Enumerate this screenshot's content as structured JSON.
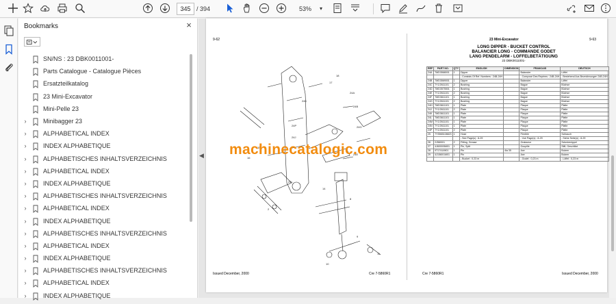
{
  "toolbar": {
    "page_current": "345",
    "page_total": "/  394",
    "zoom": "53%"
  },
  "bookmarks_panel": {
    "title": "Bookmarks",
    "close": "×",
    "items": [
      {
        "label": "SN/NS : 23 DBK0011001-",
        "expandable": false
      },
      {
        "label": "Parts Catalogue - Catalogue Pièces",
        "expandable": false
      },
      {
        "label": "Ersatzteilkatalog",
        "expandable": false
      },
      {
        "label": "23 Mini-Excavator",
        "expandable": false
      },
      {
        "label": "Mini-Pelle 23",
        "expandable": false
      },
      {
        "label": "Minibagger 23",
        "expandable": true
      },
      {
        "label": "ALPHABETICAL INDEX",
        "expandable": true
      },
      {
        "label": "INDEX ALPHABETIQUE",
        "expandable": true
      },
      {
        "label": "ALPHABETISCHES INHALTSVERZEICHNIS",
        "expandable": true
      },
      {
        "label": "ALPHABETICAL INDEX",
        "expandable": true
      },
      {
        "label": "INDEX ALPHABETIQUE",
        "expandable": true
      },
      {
        "label": "ALPHABETISCHES INHALTSVERZEICHNIS",
        "expandable": true
      },
      {
        "label": "ALPHABETICAL INDEX",
        "expandable": true
      },
      {
        "label": "INDEX ALPHABETIQUE",
        "expandable": true
      },
      {
        "label": "ALPHABETISCHES INHALTSVERZEICHNIS",
        "expandable": true
      },
      {
        "label": "ALPHABETICAL INDEX",
        "expandable": true
      },
      {
        "label": "INDEX ALPHABETIQUE",
        "expandable": true
      },
      {
        "label": "ALPHABETISCHES INHALTSVERZEICHNIS",
        "expandable": true
      },
      {
        "label": "ALPHABETICAL INDEX",
        "expandable": true
      },
      {
        "label": "INDEX ALPHABETIQUE",
        "expandable": true
      }
    ]
  },
  "document": {
    "left_page_number": "9-62",
    "right_header": "23 Mini-Excavator",
    "right_page_number": "9-63",
    "title_lines": [
      "LONG DIPPER - BUCKET CONTROL",
      "BALANCIER LONG - COMMANDE GODET",
      "LANG PENDELARM - LOFFELBETÄTIGUNG"
    ],
    "serial": "23 DBK0011001-",
    "watermark": "machinecatalogic.com",
    "footer_left": "Issued December, 2000",
    "footer_left_code": "Cre 7-5860R1",
    "footer_right_code": "Cre 7-5860R1",
    "footer_right": "Issued December, 2000",
    "table_headers": [
      "REF",
      "PART NO.",
      "QTY",
      "ENGLISH",
      "DIMENSION",
      "FRANCAIS",
      "DEUTSCH",
      "CAMES"
    ],
    "table_rows": [
      [
        "24A",
        "7MD3568001",
        "1",
        "Dipper",
        "",
        "Balancier",
        "Löffel",
        "92923"
      ],
      [
        "",
        "",
        "",
        "- Consists Of Ref. Numbers : 24B-24H",
        "",
        "- Composé Des Repères : 24B-24H",
        "- Bestehend Aus Bezeichnungen 24B-24H",
        ""
      ],
      [
        "24B",
        "7MD3569001",
        "1",
        "Dipper",
        "",
        "Balancier",
        "Löffel",
        "92923"
      ],
      [
        "24C",
        "7Y1/2611101",
        "2",
        "Bushing",
        "",
        "Bague",
        "Büchse",
        "92923"
      ],
      [
        "24D",
        "7MD3575501",
        "1",
        "Bushing",
        "",
        "Bague",
        "Büchse",
        "92923"
      ],
      [
        "24E",
        "7Y1/2611101",
        "2",
        "Bushing",
        "",
        "Bague",
        "Büchse",
        "92923"
      ],
      [
        "24F",
        "7MD3611101",
        "1",
        "Bushing",
        "",
        "Bague",
        "Büchse",
        "92923"
      ],
      [
        "24G",
        "7Y1/2611101",
        "2",
        "Bushing",
        "",
        "Bague",
        "Büchse",
        "92923"
      ],
      [
        "24H",
        "7MD3611101",
        "1",
        "Plate",
        "",
        "Plaque",
        "Platte",
        "92923"
      ],
      [
        "24J",
        "7Y1/2611101",
        "2",
        "Plate",
        "",
        "Plaque",
        "Platte",
        "92923"
      ],
      [
        "24K",
        "7MD3611101",
        "1",
        "Plate",
        "",
        "Plaque",
        "Platte",
        "92923"
      ],
      [
        "24L",
        "7MD3611101",
        "1",
        "Plate",
        "",
        "Plaque",
        "Platte",
        "92923"
      ],
      [
        "24M",
        "7Y1/2611101",
        "1",
        "Plate",
        "",
        "Plaque",
        "Platte",
        "92923"
      ],
      [
        "24N",
        "7Y1/2611101",
        "1",
        "Plate",
        "",
        "Plaque",
        "Platte",
        "92923"
      ],
      [
        "24P",
        "7Y1/2611101",
        "2",
        "Plate",
        "",
        "Plaque",
        "Platte",
        "92923"
      ],
      [
        "25",
        "7Y5565108823",
        "1",
        "Hose",
        "",
        "Flexible",
        "Schlauch",
        "92923"
      ],
      [
        "",
        "",
        "",
        "- See Page(s) : 8-29",
        "",
        "- Voir Page(s) : 8-29",
        "- Siehe Seite(n) : 8-29",
        ""
      ],
      [
        "26",
        "2J5600/1",
        "2",
        "Fitting, Grease",
        "",
        "Graisseur",
        "Schmiernippel",
        "90151"
      ],
      [
        "27",
        "4J6000/5M01",
        "1",
        "Pin, Split",
        "",
        "Goupille",
        "Stift, Geschlitzt",
        "92923"
      ],
      [
        "28",
        "9T1741/M01",
        "1",
        "Pin",
        "4ia 35",
        "Axe",
        "Bolzen",
        "92923"
      ],
      [
        "29",
        "4J1560/1M01",
        "1",
        "Pin",
        "",
        "Axe",
        "Bolzen",
        "92923"
      ],
      [
        "",
        "",
        "",
        "- Bucket : 0.23 m",
        "",
        "- Godet : 0,23 m",
        "- Löffel : 0,23 m",
        ""
      ]
    ]
  },
  "colors": {
    "watermark": "#f28c0f",
    "toolbar_bg": "#f9f9f9",
    "panel_bg": "#ffffff",
    "doc_bg": "#e6e6e6"
  }
}
